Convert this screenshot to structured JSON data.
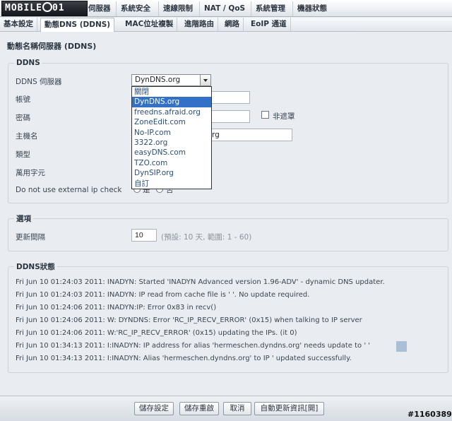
{
  "logo": {
    "text_a": "MOBILE",
    "text_b": "01"
  },
  "topnav": {
    "items": [
      {
        "label": "伺服器"
      },
      {
        "label": "系統安全"
      },
      {
        "label": "速線限制"
      },
      {
        "label": "NAT / QoS"
      },
      {
        "label": "系統管理"
      },
      {
        "label": "機器狀態"
      }
    ]
  },
  "subnav": {
    "items": [
      {
        "label": "基本設定"
      },
      {
        "label": "動態DNS (DDNS)"
      },
      {
        "label": "MAC位址複製"
      },
      {
        "label": "進階路由"
      },
      {
        "label": "網路"
      },
      {
        "label": "EoIP 通道"
      }
    ]
  },
  "page": {
    "title": "動態名稱伺服器 (DDNS)"
  },
  "ddns": {
    "legend": "DDNS",
    "server_label": "DDNS 伺服器",
    "server_value": "DynDNS.org",
    "username_label": "帳號",
    "password_label": "密碼",
    "unmask_label": "非遮罩",
    "hostname_label": "主機名",
    "hostname_value_tail": "rg",
    "type_label": "類型",
    "wildcard_label": "萬用字元",
    "external_ip_label": "Do not use external ip check",
    "radio_yes": "是",
    "radio_no": "否"
  },
  "dropdown": {
    "options": [
      "關閉",
      "DynDNS.org",
      "freedns.afraid.org",
      "ZoneEdit.com",
      "No-IP.com",
      "3322.org",
      "easyDNS.com",
      "TZO.com",
      "DynSIP.org",
      "自訂"
    ],
    "selected": "DynDNS.org"
  },
  "options": {
    "legend": "選項",
    "interval_label": "更新間隔",
    "interval_value": "10",
    "interval_hint": "(預設: 10 天, 範圍: 1 - 60)"
  },
  "status": {
    "legend": "DDNS狀態",
    "lines": [
      "Fri Jun 10 01:24:03 2011: INADYN: Started 'INADYN Advanced version 1.96-ADV' - dynamic DNS updater.",
      "Fri Jun 10 01:24:03 2011: INADYN: IP read from cache file is '                    '. No update required.",
      "Fri Jun 10 01:24:06 2011: INADYN:IP: Error 0x83 in recv()",
      "Fri Jun 10 01:24:06 2011: W: DYNDNS: Error 'RC_IP_RECV_ERROR' (0x15) when talking to IP server",
      "Fri Jun 10 01:24:06 2011: W:'RC_IP_RECV_ERROR' (0x15) updating the IPs. (it 0)",
      "Fri Jun 10 01:34:13 2011: I:INADYN: IP address for alias 'hermeschen.dyndns.org' needs update to '                  '",
      "Fri Jun 10 01:34:13 2011: I:INADYN: Alias 'hermeschen.dyndns.org' to IP                        ' updated successfully."
    ]
  },
  "footer": {
    "save_settings": "儲存設定",
    "save_reboot": "儲存重啟",
    "cancel": "取消",
    "auto_refresh": "自動更新資訊[開]"
  },
  "watermark": "#1160389"
}
